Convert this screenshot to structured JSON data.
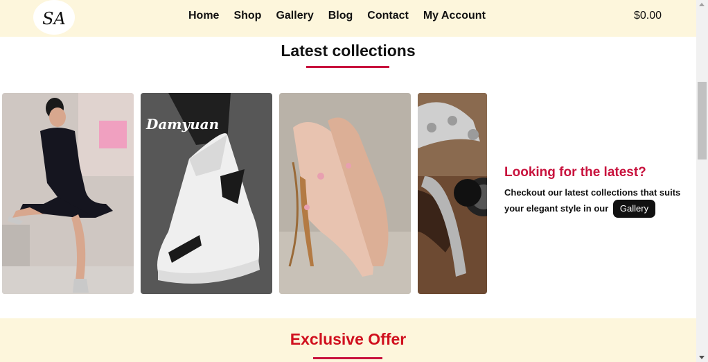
{
  "header": {
    "logo_text": "SA",
    "nav": [
      {
        "label": "Home"
      },
      {
        "label": "Shop"
      },
      {
        "label": "Gallery"
      },
      {
        "label": "Blog"
      },
      {
        "label": "Contact"
      },
      {
        "label": "My Account"
      }
    ],
    "cart_total": "$0.00"
  },
  "latest": {
    "title": "Latest collections",
    "cards": [
      {
        "alt": "Woman in black dress"
      },
      {
        "alt": "White sneaker",
        "brand": "Damyuan"
      },
      {
        "alt": "Rose gold heel"
      },
      {
        "alt": "Watches and bracelets"
      }
    ],
    "promo": {
      "heading": "Looking for the latest?",
      "text": "Checkout our latest collections that suits your elegant style in our",
      "button": "Gallery"
    }
  },
  "offer": {
    "title": "Exclusive Offer"
  },
  "colors": {
    "accent": "#c8123d",
    "band": "#fdf6dc",
    "offer_title": "#d0101e"
  }
}
